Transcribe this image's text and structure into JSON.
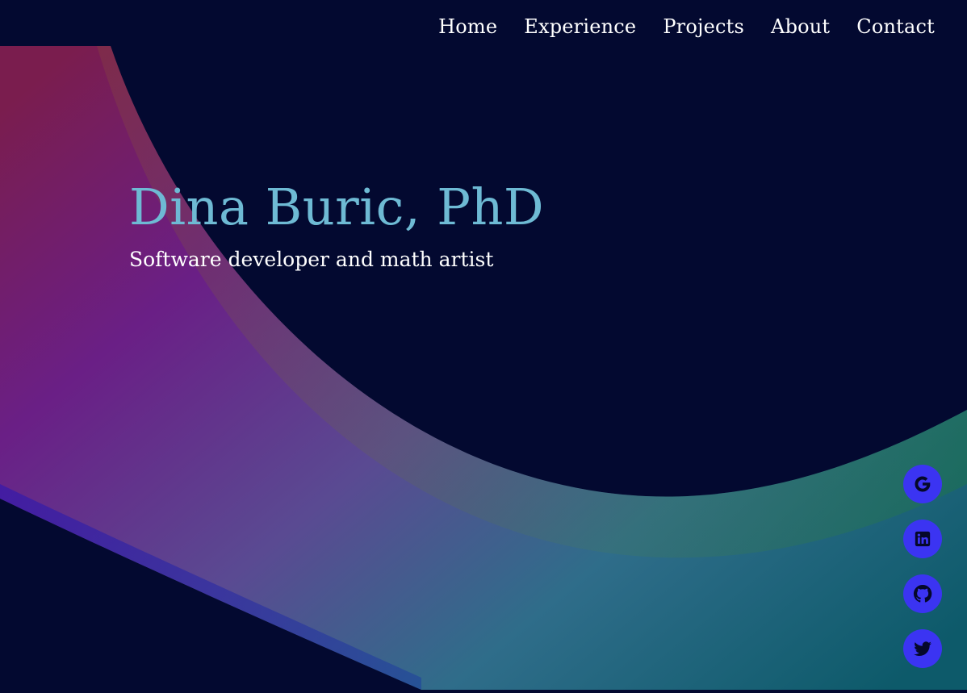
{
  "nav": {
    "items": [
      {
        "label": "Home"
      },
      {
        "label": "Experience"
      },
      {
        "label": "Projects"
      },
      {
        "label": "About"
      },
      {
        "label": "Contact"
      }
    ]
  },
  "hero": {
    "title": "Dina Buric, PhD",
    "subtitle": "Software developer and math artist"
  },
  "social": [
    {
      "icon": "google-icon"
    },
    {
      "icon": "linkedin-icon"
    },
    {
      "icon": "github-icon"
    },
    {
      "icon": "twitter-icon"
    }
  ],
  "colors": {
    "background": "#030930",
    "title": "#6ebad4",
    "social_button": "#3b34f2",
    "text": "#ffffff"
  }
}
